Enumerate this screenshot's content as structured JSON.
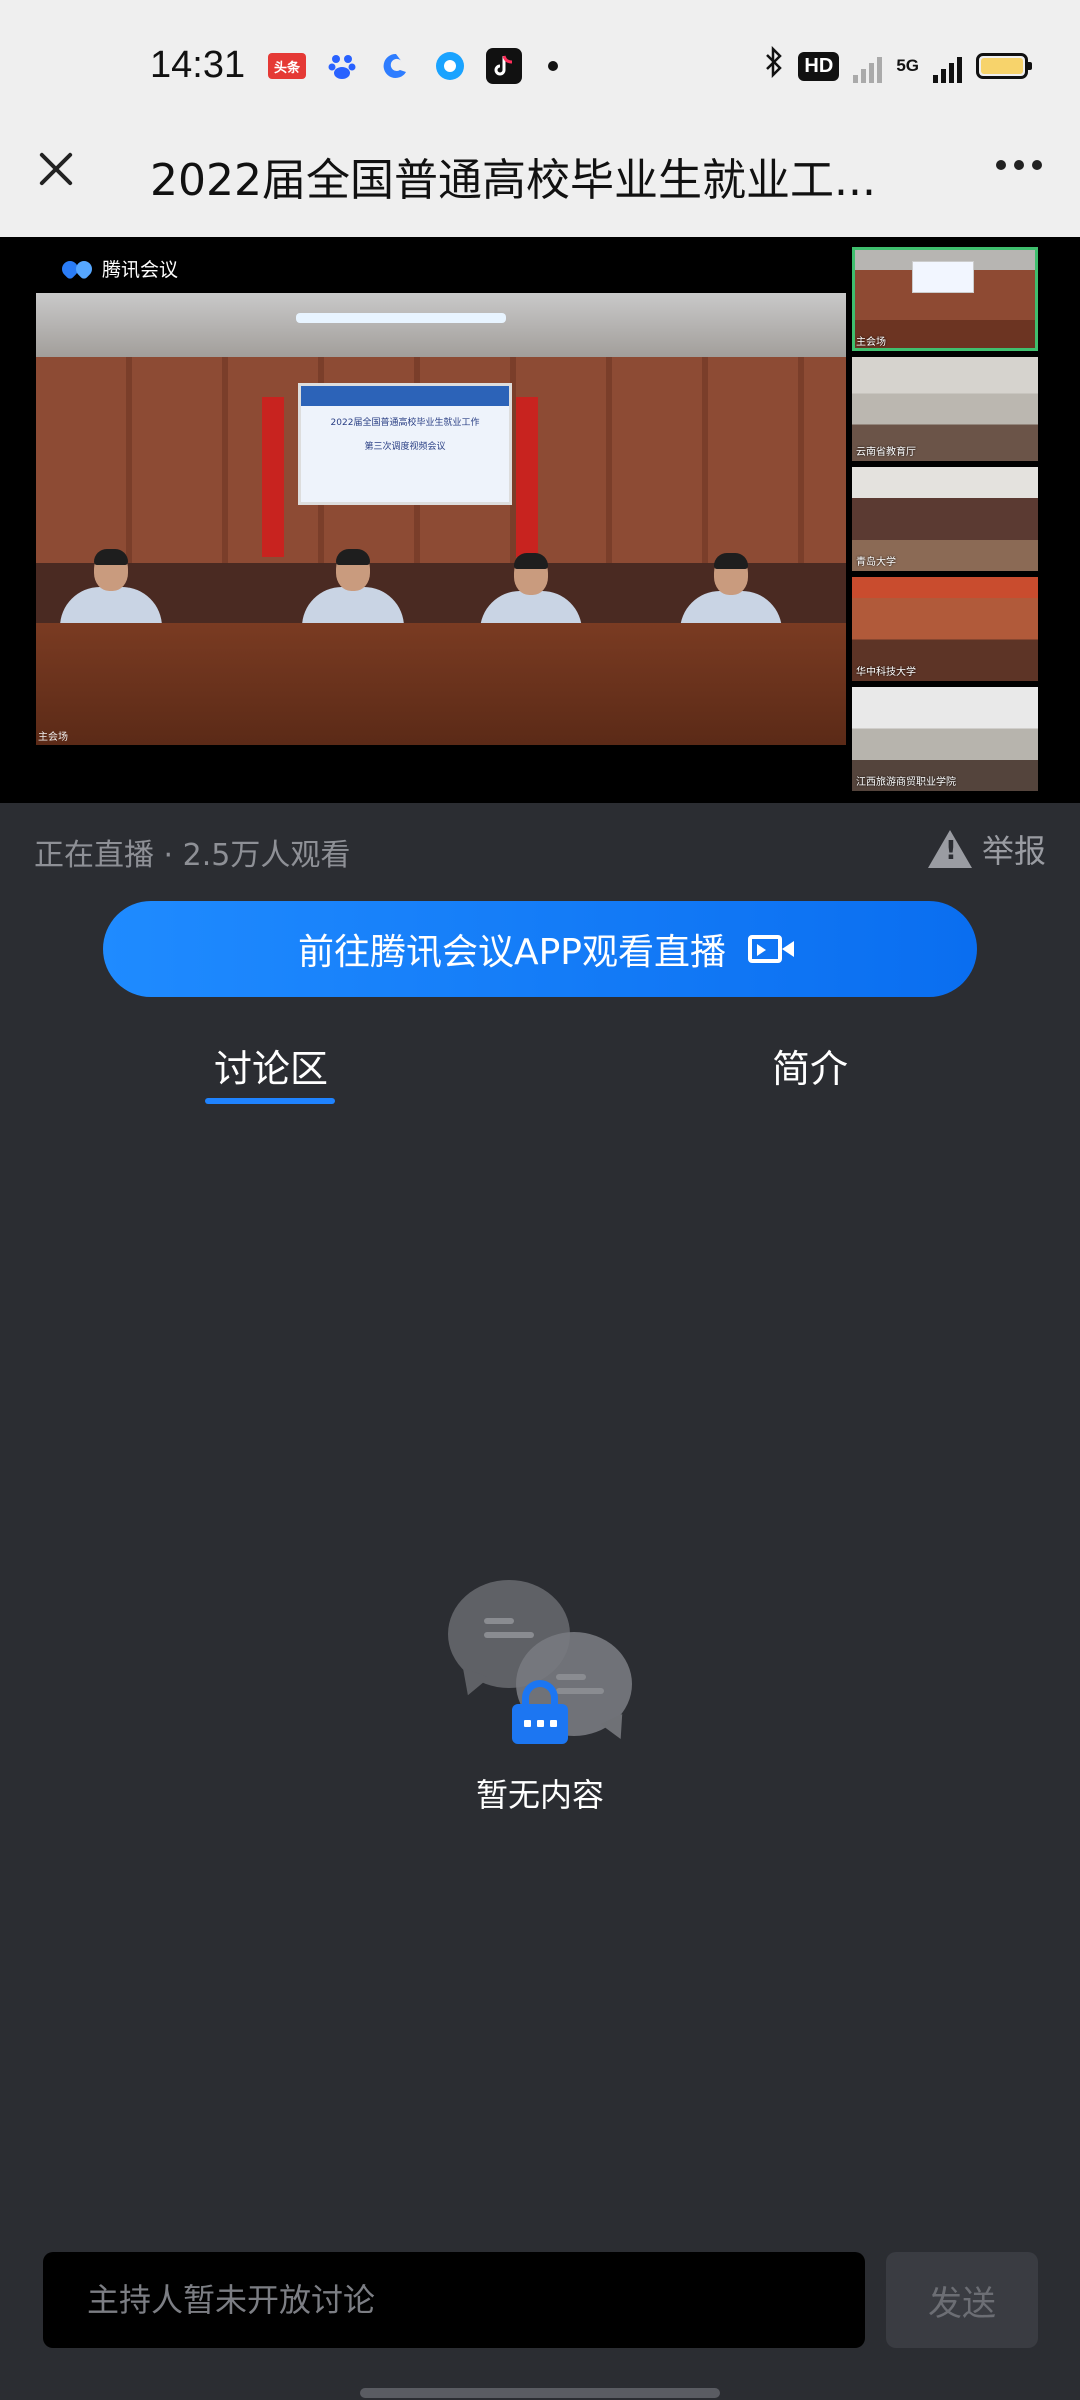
{
  "status_bar": {
    "time": "14:31",
    "notification_icons": [
      "toutiao-icon",
      "baidu-icon",
      "quark-icon",
      "tencent-video-icon",
      "tiktok-icon"
    ],
    "toutiao_label": "头条",
    "hd_label": "HD",
    "network_label": "5G",
    "battery_color": "#f7d36b"
  },
  "header": {
    "title": "2022届全国普通高校毕业生就业工..."
  },
  "video": {
    "brand": "腾讯会议",
    "screen_line1": "2022届全国普通高校毕业生就业工作",
    "screen_line2": "第三次调度视频会议",
    "main_label": "主会场",
    "thumbnails": [
      {
        "label": "主会场"
      },
      {
        "label": "云南省教育厅"
      },
      {
        "label": "青岛大学"
      },
      {
        "label": "华中科技大学"
      },
      {
        "label": "江西旅游商贸职业学院"
      }
    ]
  },
  "live": {
    "status": "正在直播 · 2.5万人观看",
    "report_label": "举报"
  },
  "app_button": {
    "label": "前往腾讯会议APP观看直播",
    "color": "#1f8bff"
  },
  "tabs": [
    {
      "label": "讨论区",
      "active": true
    },
    {
      "label": "简介",
      "active": false
    }
  ],
  "empty_state": {
    "text": "暂无内容"
  },
  "comment_bar": {
    "placeholder": "主持人暂未开放讨论",
    "send_label": "发送"
  },
  "colors": {
    "accent": "#1f83ff",
    "background": "#2b2d32"
  }
}
